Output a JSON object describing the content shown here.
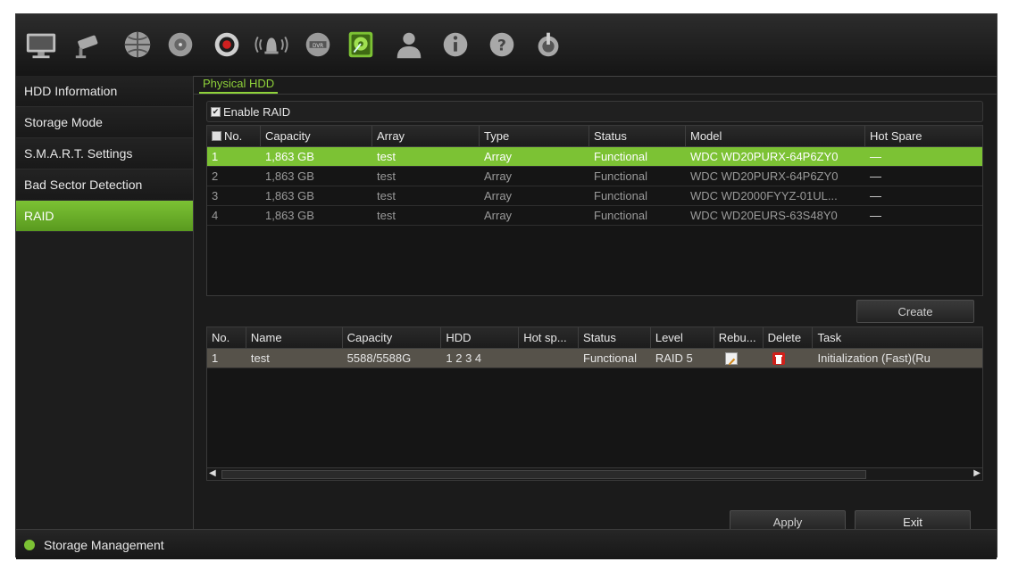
{
  "toolbar": {
    "icons": [
      "monitor-icon",
      "camera-icon",
      "network-icon",
      "record-icon",
      "alarm-icon",
      "device-icon",
      "storage-icon",
      "user-icon",
      "info-icon",
      "help-icon",
      "power-icon"
    ]
  },
  "sidebar": {
    "items": [
      {
        "label": "HDD Information"
      },
      {
        "label": "Storage Mode"
      },
      {
        "label": "S.M.A.R.T. Settings"
      },
      {
        "label": "Bad Sector Detection"
      },
      {
        "label": "RAID"
      }
    ],
    "active_index": 4
  },
  "main": {
    "tab_label": "Physical HDD",
    "enable_raid_label": "Enable RAID",
    "enable_raid_checked": true,
    "physical_table": {
      "headers": [
        "No.",
        "Capacity",
        "Array",
        "Type",
        "Status",
        "Model",
        "Hot Spare"
      ],
      "rows": [
        {
          "no": "1",
          "capacity": "1,863 GB",
          "array": "test",
          "type": "Array",
          "status": "Functional",
          "model": "WDC WD20PURX-64P6ZY0",
          "hot_spare": "—"
        },
        {
          "no": "2",
          "capacity": "1,863 GB",
          "array": "test",
          "type": "Array",
          "status": "Functional",
          "model": "WDC WD20PURX-64P6ZY0",
          "hot_spare": "—"
        },
        {
          "no": "3",
          "capacity": "1,863 GB",
          "array": "test",
          "type": "Array",
          "status": "Functional",
          "model": "WDC WD2000FYYZ-01UL...",
          "hot_spare": "—"
        },
        {
          "no": "4",
          "capacity": "1,863 GB",
          "array": "test",
          "type": "Array",
          "status": "Functional",
          "model": "WDC WD20EURS-63S48Y0",
          "hot_spare": "—"
        }
      ]
    },
    "create_label": "Create",
    "array_table": {
      "headers": [
        "No.",
        "Name",
        "Capacity",
        "HDD",
        "Hot sp...",
        "Status",
        "Level",
        "Rebu...",
        "Delete",
        "Task"
      ],
      "rows": [
        {
          "no": "1",
          "name": "test",
          "capacity": "5588/5588G",
          "hdd": "1  2  3  4",
          "hot_spare": "",
          "status": "Functional",
          "level": "RAID 5",
          "task": "Initialization (Fast)(Ru"
        }
      ]
    },
    "apply_label": "Apply",
    "exit_label": "Exit"
  },
  "statusbar": {
    "label": "Storage Management"
  },
  "colors": {
    "accent": "#7cc234",
    "background": "#1b1b1b",
    "selected_row": "#56524a"
  }
}
